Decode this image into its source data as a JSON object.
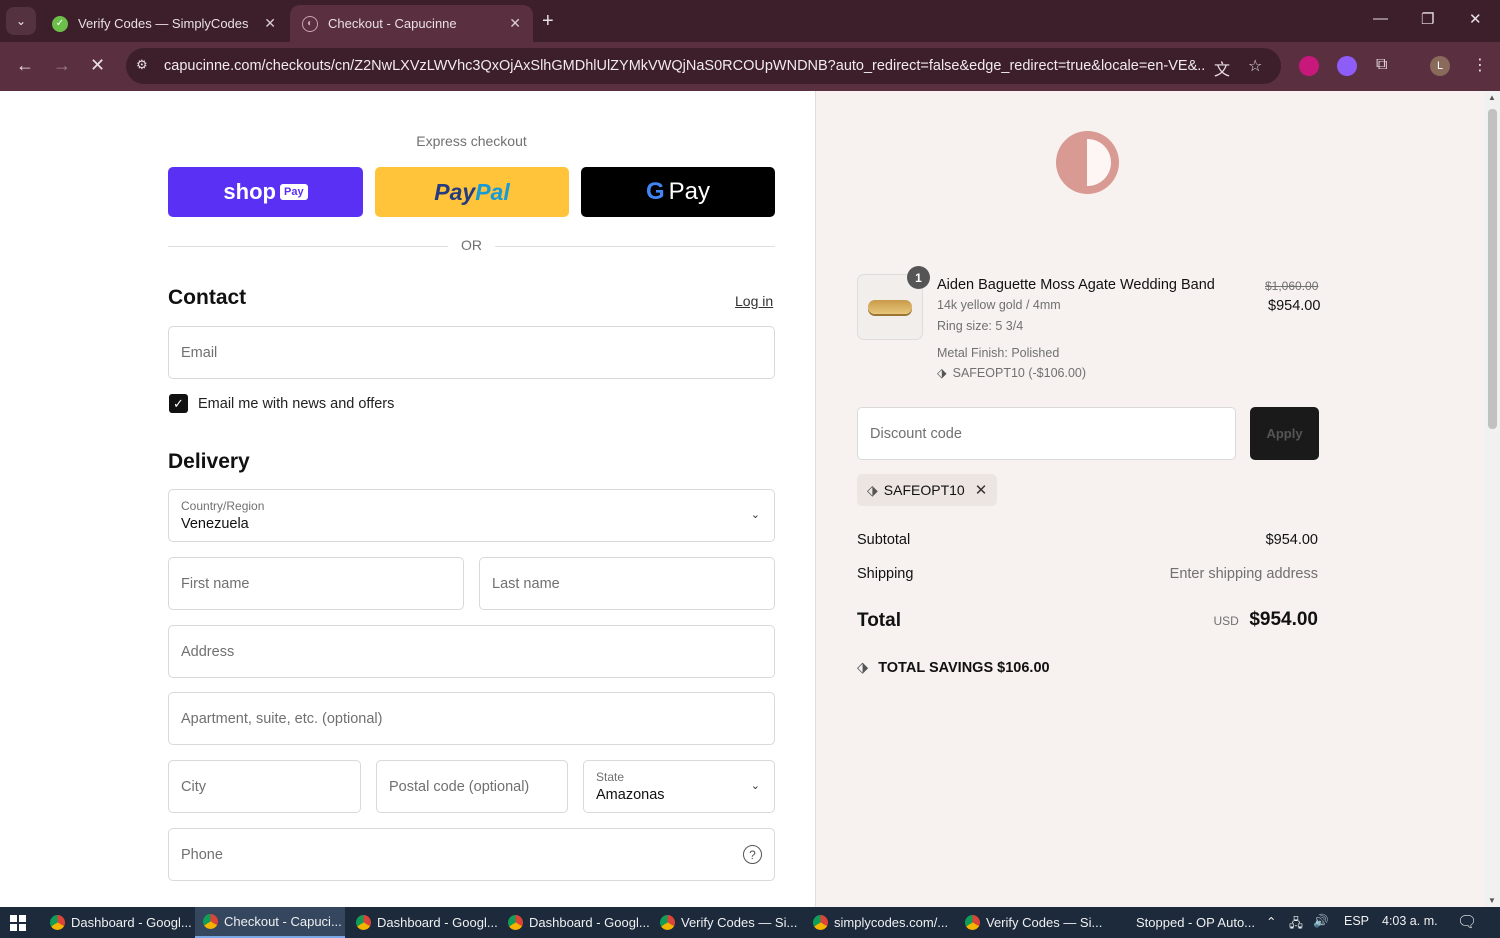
{
  "browser": {
    "tabs": [
      {
        "title": "Verify Codes — SimplyCodes",
        "active": false
      },
      {
        "title": "Checkout - Capucinne",
        "active": true
      }
    ],
    "url": "capucinne.com/checkouts/cn/Z2NwLXVzLWVhc3QxOjAxSlhGMDhlUlZYMkVWQjNaS0RCOUpWNDNB?auto_redirect=false&edge_redirect=true&locale=en-VE&...",
    "profile_initial": "L"
  },
  "checkout": {
    "express_label": "Express checkout",
    "shop_pay": {
      "shop": "shop",
      "pay": "Pay"
    },
    "paypal": {
      "pay": "Pay",
      "pal": "Pal"
    },
    "gpay": {
      "g": "G",
      "pay": "Pay"
    },
    "or_label": "OR",
    "contact": {
      "heading": "Contact",
      "login": "Log in",
      "email_placeholder": "Email",
      "marketing_label": "Email me with news and offers",
      "marketing_checked": true
    },
    "delivery": {
      "heading": "Delivery",
      "country_label": "Country/Region",
      "country_value": "Venezuela",
      "first_name": "First name",
      "last_name": "Last name",
      "address": "Address",
      "apartment": "Apartment, suite, etc. (optional)",
      "city": "City",
      "postal": "Postal code (optional)",
      "state_label": "State",
      "state_value": "Amazonas",
      "phone": "Phone"
    }
  },
  "summary": {
    "item": {
      "quantity": "1",
      "name": "Aiden Baguette Moss Agate Wedding Band",
      "variant": "14k yellow gold / 4mm",
      "ring_size": "Ring size: 5 3/4",
      "finish": "Metal Finish: Polished",
      "discount_line": "SAFEOPT10 (-$106.00)",
      "price_original": "$1,060.00",
      "price_final": "$954.00"
    },
    "discount_placeholder": "Discount code",
    "apply_label": "Apply",
    "applied_code": "SAFEOPT10",
    "subtotal_label": "Subtotal",
    "subtotal_value": "$954.00",
    "shipping_label": "Shipping",
    "shipping_value": "Enter shipping address",
    "total_label": "Total",
    "total_currency": "USD",
    "total_value": "$954.00",
    "savings_label": "TOTAL SAVINGS",
    "savings_value": "$106.00"
  },
  "taskbar": {
    "items": [
      {
        "label": "Dashboard - Googl...",
        "active": false
      },
      {
        "label": "Checkout - Capuci...",
        "active": true
      },
      {
        "label": "Dashboard - Googl...",
        "active": false
      },
      {
        "label": "Dashboard - Googl...",
        "active": false
      },
      {
        "label": "Verify Codes — Si...",
        "active": false
      },
      {
        "label": "simplycodes.com/...",
        "active": false
      },
      {
        "label": "Verify Codes — Si...",
        "active": false
      },
      {
        "label": "Stopped - OP Auto...",
        "active": false
      }
    ],
    "language": "ESP",
    "time": "4:03 a. m."
  },
  "colors": {
    "shop_pay": "#5a31f4",
    "paypal": "#ffc439",
    "brand_logo": "#d89a92",
    "summary_bg": "#f7f2f0",
    "chrome_tabbar": "#3c1f2b"
  }
}
